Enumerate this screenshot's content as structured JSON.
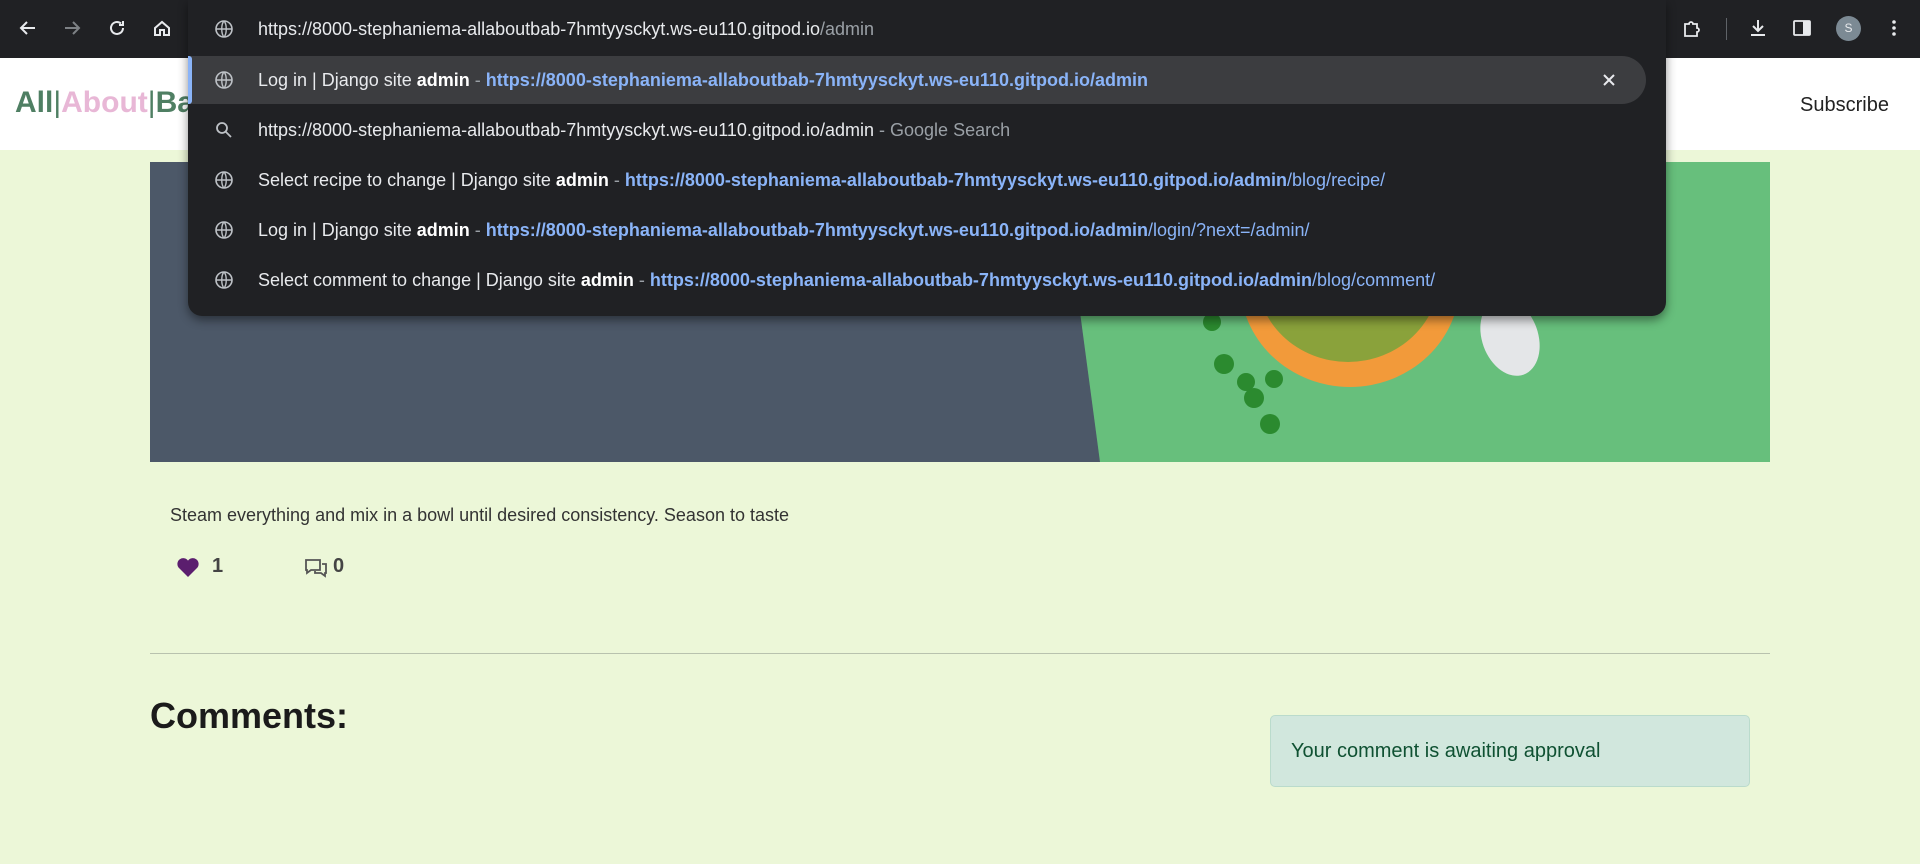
{
  "browser": {
    "omnibox_text_typed": "https://8000-stephaniema-allaboutbab-7hmtyysckyt.ws-eu110.gitpod.io",
    "omnibox_text_suffix": "/admin",
    "profile_initial": "S",
    "suggestions": [
      {
        "title_pre": "Log in | Django site ",
        "title_bold": "admin",
        "sep": " - ",
        "url_bold": "https://8000-stephaniema-allaboutbab-7hmtyysckyt.ws-eu110.gitpod.io/admin",
        "url_rest": ""
      },
      {
        "search_text": "https://8000-stephaniema-allaboutbab-7hmtyysckyt.ws-eu110.gitpod.io/admin",
        "search_suffix": " - Google Search"
      },
      {
        "title_pre": "Select recipe to change | Django site ",
        "title_bold": "admin",
        "sep": " - ",
        "url_bold": "https://8000-stephaniema-allaboutbab-7hmtyysckyt.ws-eu110.gitpod.io/admin",
        "url_rest": "/blog/recipe/"
      },
      {
        "title_pre": "Log in | Django site ",
        "title_bold": "admin",
        "sep": " - ",
        "url_bold": "https://8000-stephaniema-allaboutbab-7hmtyysckyt.ws-eu110.gitpod.io/admin",
        "url_rest": "/login/?next=/admin/"
      },
      {
        "title_pre": "Select comment to change | Django site ",
        "title_bold": "admin",
        "sep": " - ",
        "url_bold": "https://8000-stephaniema-allaboutbab-7hmtyysckyt.ws-eu110.gitpod.io/admin",
        "url_rest": "/blog/comment/"
      }
    ]
  },
  "site": {
    "brand_part1": "All",
    "brand_pipe1": "|",
    "brand_part2": "About",
    "brand_pipe2": "|",
    "brand_part3": "Bab",
    "subscribe_label": "Subscribe"
  },
  "post": {
    "method_text": "Steam everything and mix in a bowl until desired consistency. Season to taste",
    "like_count": "1",
    "comment_count": "0"
  },
  "comments": {
    "heading": "Comments:",
    "awaiting_message": "Your comment is awaiting approval"
  },
  "colors": {
    "page_bg": "#ecf7d8",
    "brand_green": "#4f7f63",
    "brand_pink": "#e8b7d6",
    "heart": "#5b1e6e",
    "omnibox_link": "#8ab4f8"
  }
}
